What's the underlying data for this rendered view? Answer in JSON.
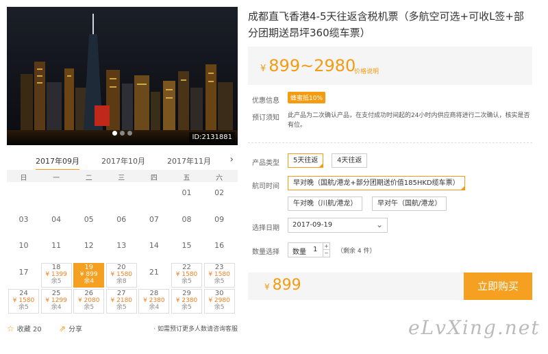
{
  "hero": {
    "id_label": "ID:2131881",
    "dots": 3
  },
  "months": [
    "2017年09月",
    "2017年10月",
    "2017年11月"
  ],
  "weekdays": [
    "日",
    "一",
    "二",
    "三",
    "四",
    "五",
    "六"
  ],
  "calendar": [
    {
      "day": "01",
      "col": 5,
      "row": 0
    },
    {
      "day": "02",
      "col": 6,
      "row": 0
    },
    {
      "day": "03",
      "col": 0,
      "row": 1
    },
    {
      "day": "04",
      "col": 1,
      "row": 1
    },
    {
      "day": "05",
      "col": 2,
      "row": 1
    },
    {
      "day": "06",
      "col": 3,
      "row": 1
    },
    {
      "day": "07",
      "col": 4,
      "row": 1
    },
    {
      "day": "08",
      "col": 5,
      "row": 1
    },
    {
      "day": "09",
      "col": 6,
      "row": 1
    },
    {
      "day": "10",
      "col": 0,
      "row": 2
    },
    {
      "day": "11",
      "col": 1,
      "row": 2
    },
    {
      "day": "12",
      "col": 2,
      "row": 2
    },
    {
      "day": "13",
      "col": 3,
      "row": 2
    },
    {
      "day": "14",
      "col": 4,
      "row": 2
    },
    {
      "day": "15",
      "col": 5,
      "row": 2
    },
    {
      "day": "16",
      "col": 6,
      "row": 2
    },
    {
      "day": "17",
      "col": 0,
      "row": 3
    },
    {
      "day": "18",
      "col": 1,
      "row": 3,
      "price": "¥ 1399",
      "stock": "余5"
    },
    {
      "day": "19",
      "col": 2,
      "row": 3,
      "price": "¥ 899",
      "stock": "余4",
      "selected": true
    },
    {
      "day": "20",
      "col": 3,
      "row": 3,
      "price": "¥ 1580",
      "stock": "余8"
    },
    {
      "day": "21",
      "col": 4,
      "row": 3
    },
    {
      "day": "22",
      "col": 5,
      "row": 3,
      "price": "¥ 1580",
      "stock": "余5"
    },
    {
      "day": "23",
      "col": 6,
      "row": 3,
      "price": "¥ 1580",
      "stock": "余5"
    },
    {
      "day": "24",
      "col": 0,
      "row": 4,
      "price": "¥ 1580",
      "stock": "余5"
    },
    {
      "day": "25",
      "col": 1,
      "row": 4,
      "price": "¥ 1299",
      "stock": "余4"
    },
    {
      "day": "26",
      "col": 2,
      "row": 4,
      "price": "¥ 2080",
      "stock": "余5"
    },
    {
      "day": "27",
      "col": 3,
      "row": 4,
      "price": "¥ 2180",
      "stock": "余5"
    },
    {
      "day": "28",
      "col": 4,
      "row": 4,
      "price": "¥ 2380",
      "stock": "余4"
    },
    {
      "day": "29",
      "col": 5,
      "row": 4,
      "price": "¥ 2380",
      "stock": "余5"
    },
    {
      "day": "30",
      "col": 6,
      "row": 4,
      "price": "¥ 2980",
      "stock": "余5"
    }
  ],
  "bottom": {
    "fav_label": "收藏 20",
    "share_label": "分享",
    "hint": "· 如需预订更多人数请咨询客服"
  },
  "product": {
    "title": "成都直飞香港4-5天往返含税机票（多航空可选+可收L签+部分团期送昂坪360缆车票）",
    "currency": "¥",
    "price_range": "899~2980",
    "price_note": "价格说明"
  },
  "info": {
    "promo_label": "优惠信息",
    "promo_badge": "蜂蜜抵10%",
    "notice_label": "预订须知",
    "notice_text": "此产品为二次确认产品，在支付成功时间起的24小时内供应商将进行二次确认，核实是否有位。"
  },
  "options": {
    "type_label": "产品类型",
    "types": [
      "5天往返",
      "4天往返"
    ],
    "flight_label": "航司时间",
    "flights": [
      "早对晚（国航/港龙+部分团期送价值185HKD缆车票）",
      "午对晚（川航/港龙）",
      "早对午（国航/港龙）"
    ],
    "date_label": "选择日期",
    "date_value": "2017-09-19",
    "qty_label": "数量选择",
    "qty_prefix": "数量",
    "qty_value": "1",
    "remain": "（剩余 4 件）"
  },
  "buy": {
    "currency": "¥",
    "price": "899",
    "button": "立即购买"
  },
  "watermark": "eLvXing.net",
  "colors": {
    "accent": "#f39c12",
    "button": "#f5a020"
  }
}
